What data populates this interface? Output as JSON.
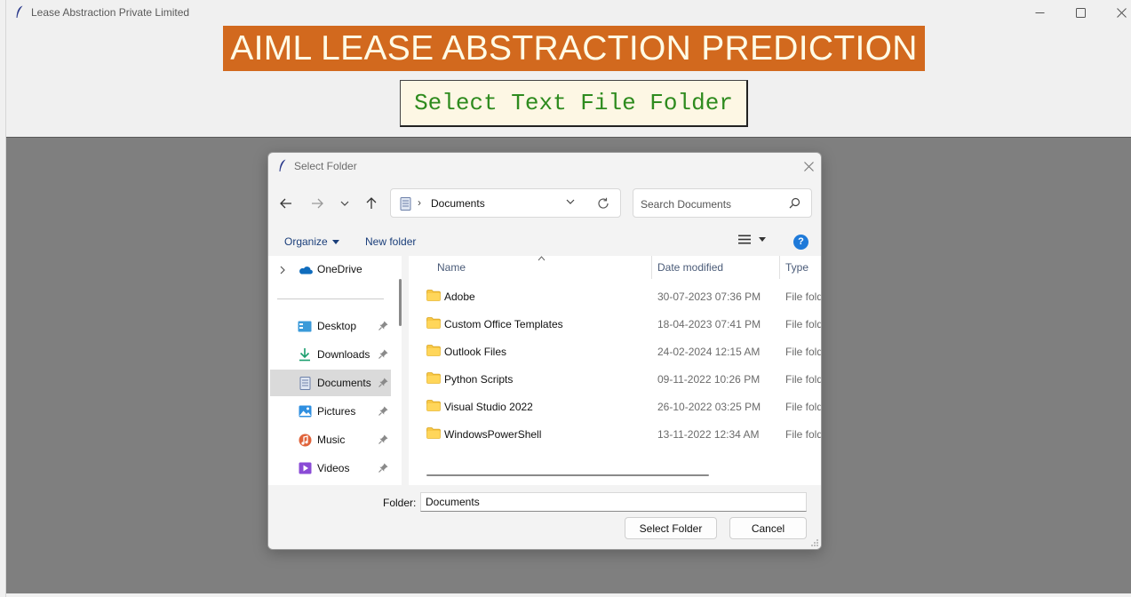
{
  "window": {
    "title": "Lease Abstraction Private Limited"
  },
  "header": {
    "banner": "AIML LEASE ABSTRACTION PREDICTION",
    "select_button": "Select Text File Folder",
    "banner_color": "#d2691e",
    "button_text_color": "#2e8b1e"
  },
  "dialog": {
    "title": "Select Folder",
    "address": {
      "location": "Documents"
    },
    "search": {
      "placeholder": "Search Documents"
    },
    "toolbar": {
      "organize": "Organize",
      "new_folder": "New folder"
    },
    "nav": {
      "onedrive": "OneDrive",
      "items": [
        {
          "label": "Desktop",
          "icon": "desktop-icon"
        },
        {
          "label": "Downloads",
          "icon": "downloads-icon"
        },
        {
          "label": "Documents",
          "icon": "documents-icon",
          "selected": true
        },
        {
          "label": "Pictures",
          "icon": "pictures-icon"
        },
        {
          "label": "Music",
          "icon": "music-icon"
        },
        {
          "label": "Videos",
          "icon": "videos-icon"
        }
      ]
    },
    "columns": [
      "Name",
      "Date modified",
      "Type"
    ],
    "files": [
      {
        "name": "Adobe",
        "date": "30-07-2023 07:36 PM",
        "type": "File fold"
      },
      {
        "name": "Custom Office Templates",
        "date": "18-04-2023 07:41 PM",
        "type": "File fold"
      },
      {
        "name": "Outlook Files",
        "date": "24-02-2024 12:15 AM",
        "type": "File fold"
      },
      {
        "name": "Python Scripts",
        "date": "09-11-2022 10:26 PM",
        "type": "File fold"
      },
      {
        "name": "Visual Studio 2022",
        "date": "26-10-2022 03:25 PM",
        "type": "File fold"
      },
      {
        "name": "WindowsPowerShell",
        "date": "13-11-2022 12:34 AM",
        "type": "File fold"
      }
    ],
    "folder_label": "Folder:",
    "folder_value": "Documents",
    "buttons": {
      "select": "Select Folder",
      "cancel": "Cancel"
    }
  }
}
